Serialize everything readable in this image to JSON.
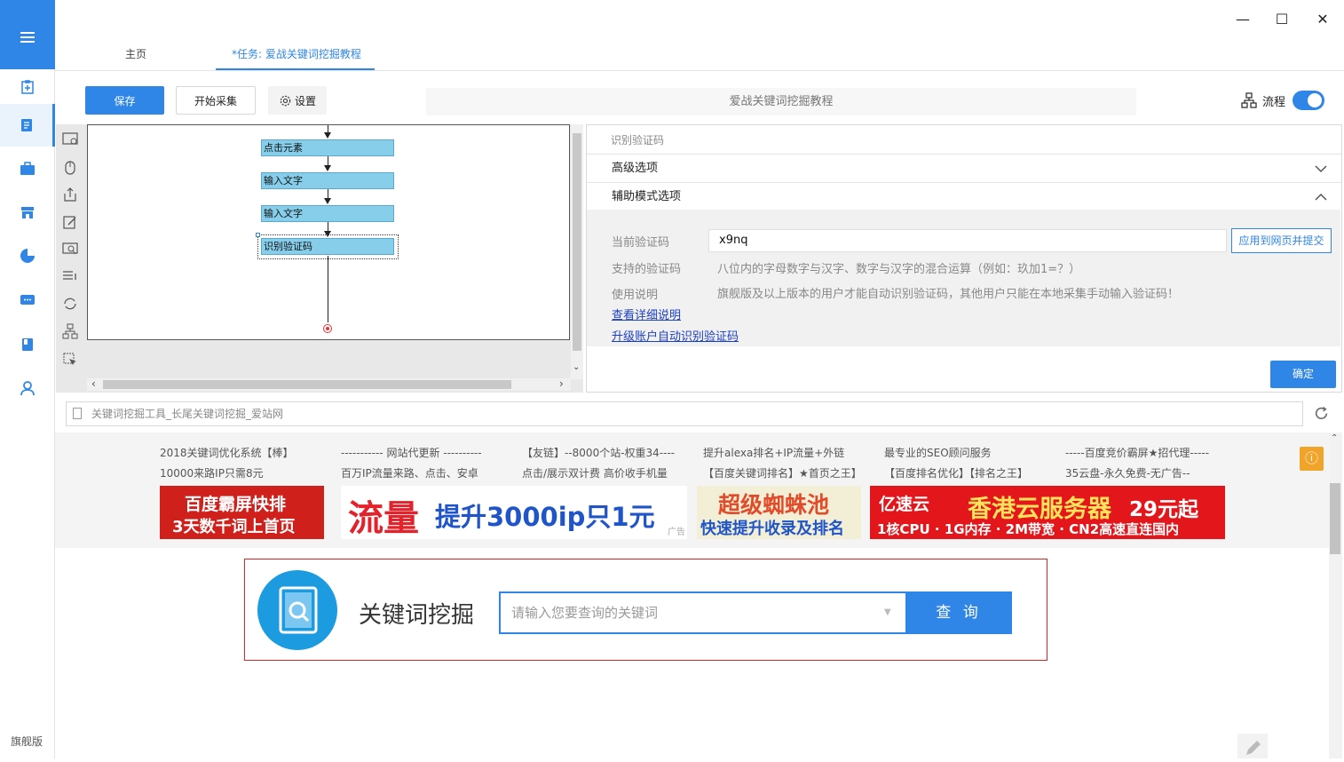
{
  "window": {
    "minimize": "—",
    "maximize": "☐",
    "close": "✕"
  },
  "sidebar": {
    "items": [
      {
        "icon": "clipboard-add-icon"
      },
      {
        "icon": "document-icon",
        "active": true
      },
      {
        "icon": "briefcase-icon"
      },
      {
        "icon": "store-icon"
      },
      {
        "icon": "pie-chart-icon"
      },
      {
        "icon": "message-icon"
      },
      {
        "icon": "book-icon"
      },
      {
        "icon": "user-icon"
      }
    ],
    "edition": "旗舰版"
  },
  "tabs": {
    "home": "主页",
    "task": "*任务: 爱战关键词挖掘教程"
  },
  "toolbar": {
    "save": "保存",
    "start": "开始采集",
    "settings": "设置",
    "task_name": "爱战关键词挖掘教程",
    "flow": "流程",
    "flow_on": true
  },
  "designer": {
    "nodes": [
      "点击元素",
      "输入文字",
      "输入文字",
      "识别验证码"
    ],
    "tools": [
      "capture-icon",
      "mouse-icon",
      "export-icon",
      "edit-icon",
      "inspect-icon",
      "list-icon",
      "loop-icon",
      "branch-icon",
      "cursor-icon"
    ]
  },
  "properties": {
    "title": "识别验证码",
    "advanced": "高级选项",
    "assist": "辅助模式选项",
    "current_label": "当前验证码",
    "current_value": "x9nq",
    "apply": "应用到网页并提交",
    "supported_label": "支持的验证码",
    "supported_value": "八位内的字母数字与汉字、数字与汉字的混合运算（例如：玖加1=？）",
    "usage_label": "使用说明",
    "usage_value": "旗舰版及以上版本的用户才能自动识别验证码，其他用户只能在本地采集手动输入验证码！",
    "link_details": "查看详细说明",
    "link_upgrade": "升级账户自动识别验证码",
    "confirm": "确定"
  },
  "browser": {
    "address": "关键词挖掘工具_长尾关键词挖掘_爱站网",
    "ads": [
      [
        "2018关键词优化系统【棒】",
        "10000来路IP只需8元"
      ],
      [
        "----------- 网站代更新 ----------",
        "百万IP流量来路、点击、安卓"
      ],
      [
        "【友链】--8000个站-权重34----",
        "点击/展示双计费 高价收手机量"
      ],
      [
        "提升alexa排名+IP流量+外链",
        "【百度关键词排名】★首页之王】"
      ],
      [
        "最专业的SEO顾问服务",
        "【百度排名优化】【排名之王】"
      ],
      [
        "-----百度竞价霸屏★招代理-----",
        "35云盘-永久免费-无广告--"
      ]
    ],
    "banners": {
      "b1": [
        "百度霸屏快排",
        "3天数千词上首页"
      ],
      "b2": [
        "流量",
        "提升3000ip只1元"
      ],
      "b3": [
        "超级蜘蛛池",
        "快速提升收录及排名"
      ],
      "b4": [
        "亿速云",
        "香港云服务器",
        "29元起",
        "1核CPU · 1G内存 · 2M带宽 · CN2高速直连国内"
      ],
      "ad_mark": "广告"
    },
    "search": {
      "title": "关键词挖掘",
      "placeholder": "请输入您要查询的关键词",
      "button": "查 询"
    }
  }
}
